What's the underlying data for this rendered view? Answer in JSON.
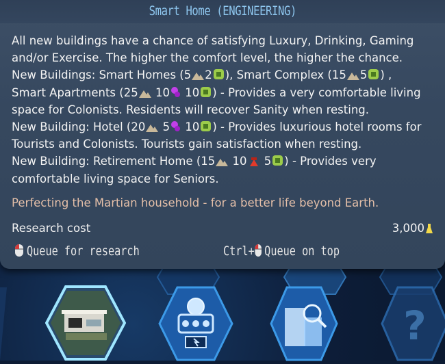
{
  "tooltip": {
    "title": "Smart Home (ENGINEERING)",
    "lines": [
      "All new buildings have a chance of satisfying Luxury, Drinking, Gaming",
      "and/or Exercise. The higher the comfort level, the higher the chance."
    ],
    "smart_homes": {
      "prefix": "New Buildings: Smart Homes (",
      "concrete": "5",
      "electronics": "2",
      "mid": "), Smart Complex (",
      "concrete2": "15",
      "electronics2": "5",
      "suffix": ") ,"
    },
    "smart_apartments": {
      "prefix": "Smart Apartments (",
      "concrete": "25",
      "polymers": "10",
      "electronics": "10",
      "suffix": ") - Provides a very comfortable living"
    },
    "apartments_cont": "space for Colonists. Residents will recover Sanity when resting.",
    "hotel": {
      "prefix": "New Building: Hotel (",
      "concrete": "20",
      "polymers": "5",
      "electronics": "10",
      "suffix": ") - Provides luxurious hotel rooms for"
    },
    "hotel_cont": "Tourists and Colonists. Tourists gain satisfaction when resting.",
    "retirement": {
      "prefix": "New Building: Retirement Home (",
      "concrete": "15",
      "metals": "10",
      "electronics": "5",
      "suffix": ") - Provides very"
    },
    "retirement_cont": "comfortable living space for Seniors.",
    "flavor": "Perfecting the Martian household - for a better life beyond Earth.",
    "research_cost_label": "Research cost",
    "research_cost_value": "3,000",
    "queue_research": "Queue for research",
    "ctrl_label": "Ctrl+",
    "queue_on_top": "Queue on top"
  },
  "icons": {
    "concrete": "concrete-icon",
    "electronics": "electronics-icon",
    "polymers": "polymers-icon",
    "metals": "metals-icon",
    "research": "research-flask-icon",
    "mouse": "mouse-icon"
  },
  "colors": {
    "title": "#8ec6ee",
    "flavor": "#e4bfa8",
    "electronics": "#9ccc4a",
    "polymers": "#c240e8",
    "metals": "#e23a2a",
    "concrete": "#c8b89a"
  }
}
